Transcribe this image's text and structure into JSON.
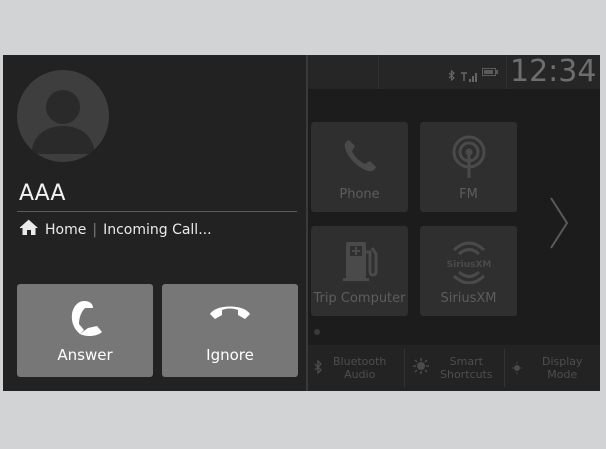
{
  "status": {
    "clock": "12:34",
    "icons": [
      "bluetooth-icon",
      "signal-icon",
      "battery-icon"
    ]
  },
  "home_tiles": [
    {
      "label": "Phone",
      "icon": "phone-icon"
    },
    {
      "label": "FM",
      "icon": "radio-antenna-icon"
    },
    {
      "label": "Trip Computer",
      "icon": "fuel-pump-icon"
    },
    {
      "label": "SiriusXM",
      "icon": "siriusxm-icon",
      "logo_text": "SiriusXM"
    }
  ],
  "bottom_bar": [
    {
      "line1": "Bluetooth",
      "line2": "Audio",
      "icon": "bluetooth-icon"
    },
    {
      "line1": "Smart",
      "line2": "Shortcuts",
      "icon": "smart-shortcuts-icon"
    },
    {
      "line1": "Display",
      "line2": "Mode",
      "icon": "display-mode-icon"
    }
  ],
  "call": {
    "caller_name": "AAA",
    "location": "Home",
    "separator": "|",
    "status": "Incoming Call...",
    "answer_label": "Answer",
    "ignore_label": "Ignore"
  },
  "colors": {
    "panel": "#222222",
    "button": "#777777",
    "tile": "#2f2f2f",
    "text_dim": "#5e5e5e"
  }
}
